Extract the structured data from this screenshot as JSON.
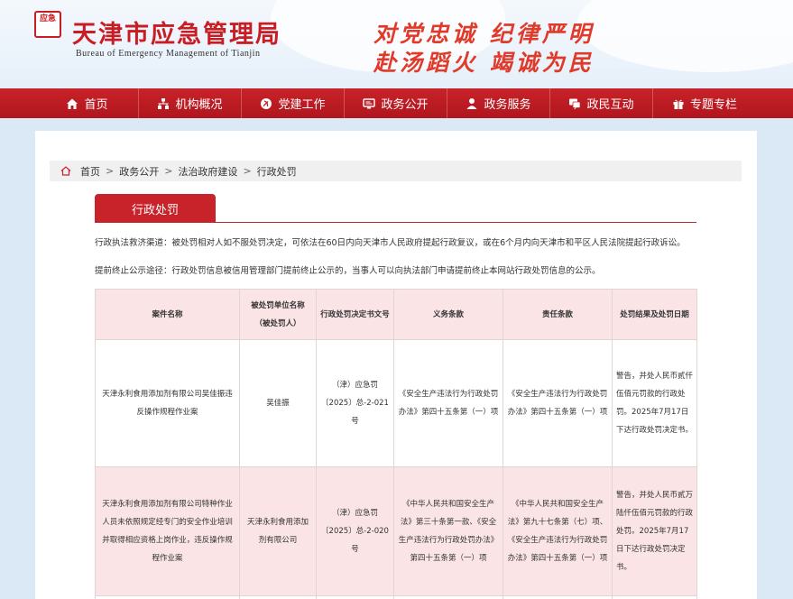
{
  "header": {
    "emblem_text": "应急",
    "emblem_sub": "",
    "title": "天津市应急管理局",
    "subtitle": "Bureau of Emergency Management of Tianjin",
    "slogan_line1": "对党忠诚  纪律严明",
    "slogan_line2": "赴汤蹈火  竭诚为民"
  },
  "nav": {
    "items": [
      {
        "label": "首页",
        "icon": "home-icon"
      },
      {
        "label": "机构概况",
        "icon": "org-icon"
      },
      {
        "label": "党建工作",
        "icon": "party-icon"
      },
      {
        "label": "政务公开",
        "icon": "screen-icon"
      },
      {
        "label": "政务服务",
        "icon": "user-icon"
      },
      {
        "label": "政民互动",
        "icon": "chat-icon"
      },
      {
        "label": "专题专栏",
        "icon": "gift-icon"
      }
    ]
  },
  "breadcrumb": {
    "items": [
      "首页",
      "政务公开",
      "法治政府建设",
      "行政处罚"
    ],
    "separator": ">"
  },
  "section": {
    "tab_label": "行政处罚"
  },
  "notices": {
    "line1": "行政执法救济渠道：被处罚相对人如不服处罚决定，可依法在60日内向天津市人民政府提起行政复议，或在6个月内向天津市和平区人民法院提起行政诉讼。",
    "line2": "提前终止公示途径：行政处罚信息被信用管理部门提前终止公示的，当事人可以向执法部门申请提前终止本网站行政处罚信息的公示。"
  },
  "table": {
    "headers": [
      "案件名称",
      "被处罚单位名称（被处罚人）",
      "行政处罚决定书文号",
      "义务条款",
      "责任条款",
      "处罚结果及处罚日期"
    ],
    "rows": [
      [
        "天津永利食用添加剂有限公司吴佳振违反操作规程作业案",
        "吴佳振",
        "（津）应急罚〔2025〕总-2-021号",
        "《安全生产违法行为行政处罚办法》第四十五条第（一）项",
        "《安全生产违法行为行政处罚办法》第四十五条第（一）项",
        "警告，并处人民币贰仟伍佰元罚款的行政处罚。2025年7月17日下达行政处罚决定书。"
      ],
      [
        "天津永利食用添加剂有限公司特种作业人员未依照规定经专门的安全作业培训并取得相应资格上岗作业，违反操作规程作业案",
        "天津永利食用添加剂有限公司",
        "（津）应急罚〔2025〕总-2-020号",
        "《中华人民共和国安全生产法》第三十条第一款、《安全生产违法行为行政处罚办法》第四十五条第（一）项",
        "《中华人民共和国安全生产法》第九十七条第（七）项、《安全生产违法行为行政处罚办法》第四十五条第（一）项",
        "警告，并处人民币贰万陆仟伍佰元罚款的行政处罚。2025年7月17日下达行政处罚决定书。"
      ]
    ]
  },
  "colors": {
    "brand_red": "#c8222a",
    "header_bg": "#eef4fb",
    "table_pink": "#fbe4e6",
    "slogan_red": "#e03a2a"
  }
}
